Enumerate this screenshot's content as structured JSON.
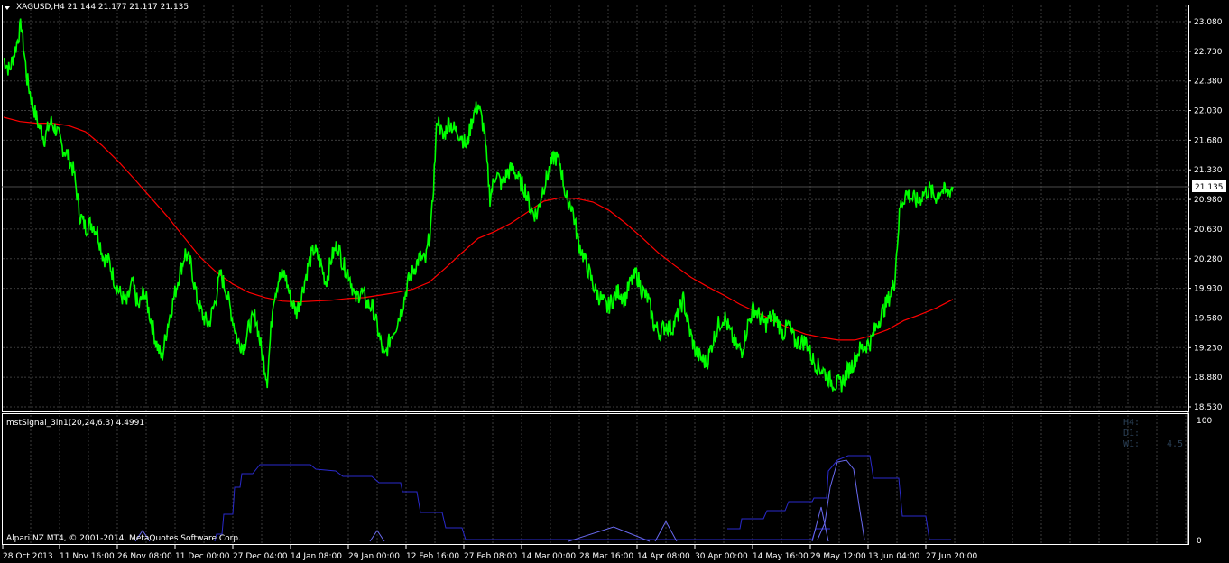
{
  "window": {
    "symbol_header": "XAGUSD,H4  21.144 21.177 21.117 21.135",
    "current_price_label": "21.135",
    "copyright": "Alpari NZ MT4, © 2001-2014, MetaQuotes Software Corp."
  },
  "indicator": {
    "header": "mstSignal_3in1(20,24,6.3) 4.4991",
    "scale_top": "100",
    "scale_bottom": "0",
    "tf_h4": "H4:",
    "tf_d1": "D1:",
    "tf_w1": "W1:",
    "tf_w1_value": "4.5"
  },
  "colors": {
    "background": "#000000",
    "grid": "#3c3c3c",
    "price": "#00ff00",
    "moving_average": "#ff0000",
    "indicator_line": "#2a2acc",
    "indicator_line_2": "#6a6af0",
    "axis_text": "#ffffff"
  },
  "chart_data": {
    "type": "line",
    "symbol": "XAGUSD",
    "timeframe": "H4",
    "current_price": 21.135,
    "y_ticks": [
      "23.080",
      "22.730",
      "22.380",
      "22.030",
      "21.680",
      "21.330",
      "20.980",
      "20.630",
      "20.280",
      "19.930",
      "19.580",
      "19.230",
      "18.880",
      "18.530"
    ],
    "ylim": [
      18.45,
      23.2
    ],
    "x_ticks": [
      "28 Oct 2013",
      "11 Nov 16:00",
      "26 Nov 08:00",
      "11 Dec 00:00",
      "27 Dec 04:00",
      "14 Jan 08:00",
      "29 Jan 00:00",
      "12 Feb 16:00",
      "27 Feb 08:00",
      "14 Mar 00:00",
      "28 Mar 16:00",
      "14 Apr 08:00",
      "30 Apr 00:00",
      "14 May 16:00",
      "29 May 12:00",
      "13 Jun 04:00",
      "27 Jun 20:00"
    ],
    "grid": true,
    "series": [
      {
        "values": [
          22.65,
          22.5,
          22.75,
          23.05,
          22.4,
          22.1,
          21.85,
          21.7,
          21.9,
          21.8,
          21.6,
          21.5,
          21.3,
          20.8,
          20.65,
          20.7,
          20.6,
          20.3,
          20.25,
          20.0,
          19.85,
          19.75,
          20.0,
          19.7,
          19.9,
          19.6,
          19.3,
          19.1,
          19.5,
          19.8,
          20.1,
          20.35,
          20.2,
          19.8,
          19.6,
          19.5,
          19.75,
          20.1,
          19.9,
          19.6,
          19.3,
          19.25,
          19.5,
          19.6,
          19.2,
          18.85,
          19.8,
          20.05,
          20.1,
          19.8,
          19.65,
          19.9,
          20.2,
          20.4,
          20.25,
          20.0,
          20.3,
          20.45,
          20.2,
          20.1,
          19.8,
          19.9,
          19.75,
          19.7,
          19.4,
          19.1,
          19.35,
          19.5,
          19.7,
          20.0,
          20.15,
          20.3,
          20.25,
          20.7,
          21.95,
          21.7,
          21.9,
          21.8,
          21.75,
          21.6,
          21.95,
          22.1,
          21.8,
          21.0,
          21.3,
          21.15,
          21.3,
          21.35,
          21.2,
          21.1,
          20.85,
          20.8,
          21.1,
          21.3,
          21.5,
          21.4,
          21.0,
          20.9,
          20.5,
          20.3,
          20.1,
          19.9,
          19.8,
          19.7,
          19.8,
          19.9,
          19.8,
          20.0,
          20.1,
          19.9,
          19.8,
          19.5,
          19.4,
          19.5,
          19.45,
          19.6,
          19.8,
          19.45,
          19.2,
          19.1,
          19.05,
          19.3,
          19.5,
          19.6,
          19.4,
          19.25,
          19.2,
          19.5,
          19.7,
          19.6,
          19.5,
          19.6,
          19.55,
          19.4,
          19.5,
          19.3,
          19.3,
          19.3,
          19.1,
          19.0,
          18.95,
          18.85,
          18.8,
          18.8,
          18.95,
          19.05,
          19.2,
          19.25,
          19.3,
          19.5,
          19.65,
          19.8,
          20.0,
          20.9,
          21.05,
          21.0,
          20.95,
          21.05,
          21.1,
          21.0,
          21.1,
          21.05,
          21.13
        ]
      },
      {
        "values": [
          21.95,
          21.9,
          21.88,
          21.88,
          21.85,
          21.78,
          21.62,
          21.43,
          21.22,
          21.0,
          20.78,
          20.54,
          20.3,
          20.12,
          19.98,
          19.88,
          19.82,
          19.78,
          19.77,
          19.78,
          19.79,
          19.81,
          19.82,
          19.85,
          19.88,
          19.92,
          20.0,
          20.17,
          20.35,
          20.52,
          20.6,
          20.7,
          20.83,
          20.96,
          21.0,
          20.99,
          20.95,
          20.85,
          20.7,
          20.53,
          20.35,
          20.2,
          20.06,
          19.95,
          19.85,
          19.74,
          19.65,
          19.55,
          19.46,
          19.39,
          19.35,
          19.32,
          19.32,
          19.37,
          19.44,
          19.55,
          19.62,
          19.7,
          19.8
        ]
      }
    ]
  }
}
